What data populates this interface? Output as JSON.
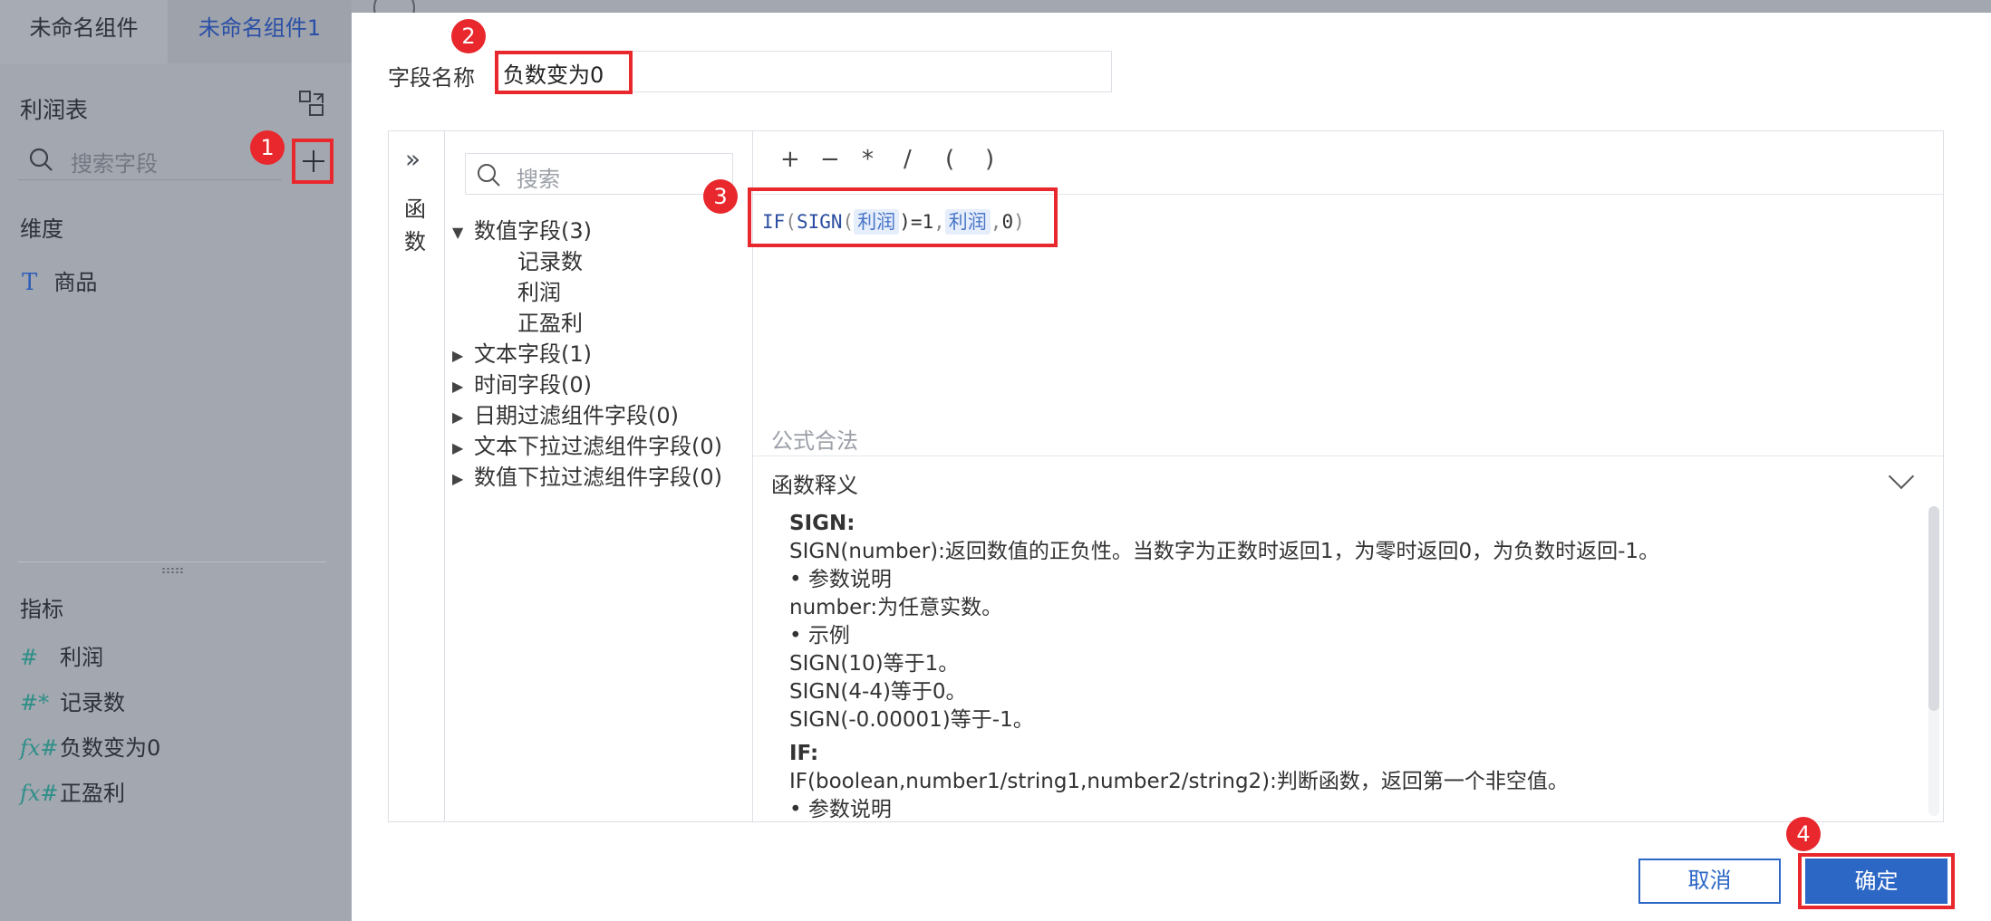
{
  "tabs": [
    "未命名组件",
    "未命名组件1"
  ],
  "sidebar": {
    "dataset_title": "利润表",
    "search_placeholder": "搜索字段",
    "dimension_label": "维度",
    "dimensions": [
      {
        "icon": "text-type-icon",
        "icon_glyph": "T",
        "label": "商品"
      }
    ],
    "measure_label": "指标",
    "measures": [
      {
        "icon": "number-type-icon",
        "icon_glyph": "#",
        "label": "利润"
      },
      {
        "icon": "record-count-icon",
        "icon_glyph": "#*",
        "label": "记录数"
      },
      {
        "icon": "calc-field-icon",
        "icon_glyph": "fx#",
        "label": "负数变为0"
      },
      {
        "icon": "calc-field-icon",
        "icon_glyph": "fx#",
        "label": "正盈利"
      }
    ]
  },
  "dialog": {
    "field_name_label": "字段名称",
    "field_name_value": "负数变为0",
    "function_panel_label": "函数",
    "tree_search_placeholder": "搜索",
    "tree": {
      "groups": [
        {
          "label": "数值字段(3)",
          "expanded": true,
          "items": [
            "记录数",
            "利润",
            "正盈利"
          ]
        },
        {
          "label": "文本字段(1)",
          "expanded": false
        },
        {
          "label": "时间字段(0)",
          "expanded": false
        },
        {
          "label": "日期过滤组件字段(0)",
          "expanded": false
        },
        {
          "label": "文本下拉过滤组件字段(0)",
          "expanded": false
        },
        {
          "label": "数值下拉过滤组件字段(0)",
          "expanded": false
        }
      ]
    },
    "operators": [
      "+",
      "−",
      "*",
      "/",
      "(",
      ")"
    ],
    "formula": {
      "if": "IF",
      "paren_open": "(",
      "sign": "SIGN",
      "field1": "利润",
      "mid": ")=1",
      "comma1": ",",
      "field2": "利润",
      "comma2": ",",
      "zero": "0",
      "paren_close": ")"
    },
    "validity_text": "公式合法",
    "explain_title": "函数释义",
    "explain_lines": [
      {
        "bold": true,
        "text": "SIGN:"
      },
      {
        "bold": false,
        "text": "SIGN(number):返回数值的正负性。当数字为正数时返回1，为零时返回0，为负数时返回-1。"
      },
      {
        "bold": false,
        "text": "• 参数说明"
      },
      {
        "bold": false,
        "text": "number:为任意实数。"
      },
      {
        "bold": false,
        "text": "• 示例"
      },
      {
        "bold": false,
        "text": "SIGN(10)等于1。"
      },
      {
        "bold": false,
        "text": "SIGN(4-4)等于0。"
      },
      {
        "bold": false,
        "text": "SIGN(-0.00001)等于-1。"
      },
      {
        "bold": true,
        "text": "IF:"
      },
      {
        "bold": false,
        "text": "IF(boolean,number1/string1,number2/string2):判断函数，返回第一个非空值。"
      },
      {
        "bold": false,
        "text": "• 参数说明"
      }
    ],
    "cancel_label": "取消",
    "ok_label": "确定"
  },
  "steps": [
    "1",
    "2",
    "3",
    "4"
  ],
  "colors": {
    "accent": "#2c67c6",
    "highlight": "#e8282c",
    "overlay": "#a3a7b0"
  }
}
